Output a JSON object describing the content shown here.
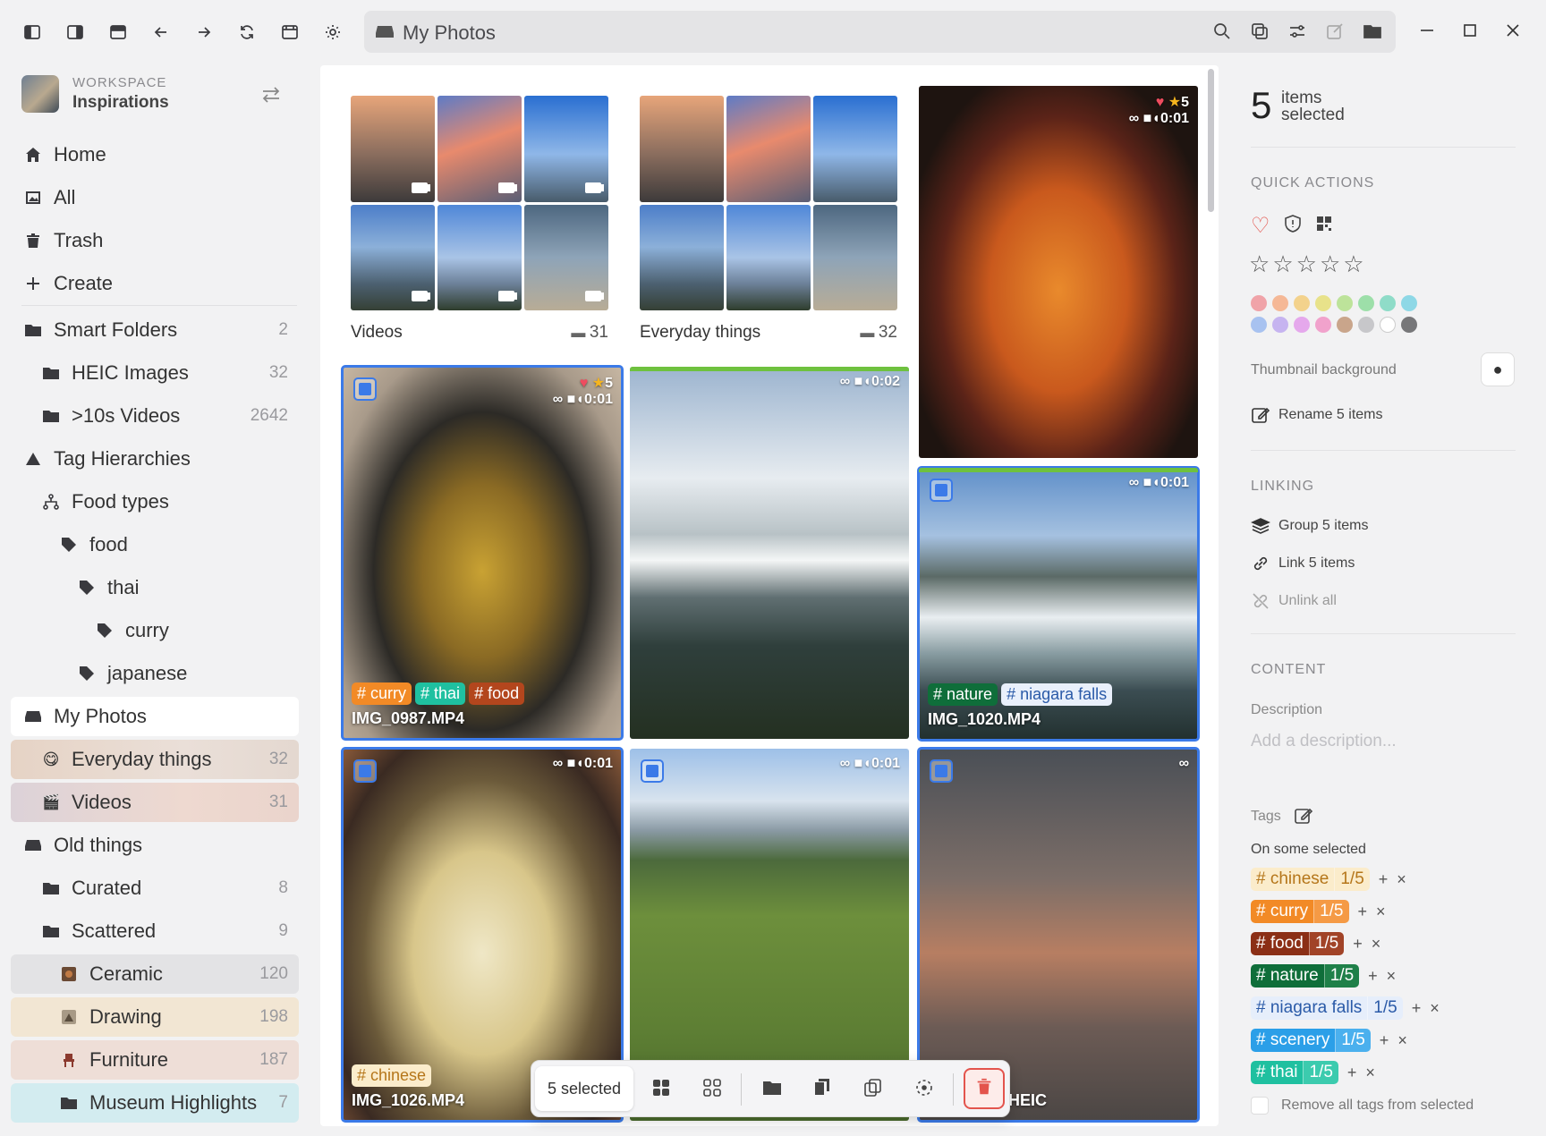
{
  "window": {
    "address_title": "My Photos"
  },
  "workspace": {
    "label": "WORKSPACE",
    "name": "Inspirations"
  },
  "sidebar": {
    "items": [
      {
        "label": "Home",
        "count": ""
      },
      {
        "label": "All",
        "count": ""
      },
      {
        "label": "Trash",
        "count": ""
      },
      {
        "label": "Create",
        "count": ""
      },
      {
        "label": "Smart Folders",
        "count": "2"
      },
      {
        "label": "HEIC Images",
        "count": "32"
      },
      {
        "label": ">10s Videos",
        "count": "2642"
      },
      {
        "label": "Tag Hierarchies",
        "count": ""
      },
      {
        "label": "Food types",
        "count": ""
      },
      {
        "label": "food",
        "count": ""
      },
      {
        "label": "thai",
        "count": ""
      },
      {
        "label": "curry",
        "count": ""
      },
      {
        "label": "japanese",
        "count": ""
      },
      {
        "label": "My Photos",
        "count": ""
      },
      {
        "label": "Everyday things",
        "count": "32"
      },
      {
        "label": "Videos",
        "count": "31"
      },
      {
        "label": "Old things",
        "count": ""
      },
      {
        "label": "Curated",
        "count": "8"
      },
      {
        "label": "Scattered",
        "count": "9"
      },
      {
        "label": "Ceramic",
        "count": "120"
      },
      {
        "label": "Drawing",
        "count": "198"
      },
      {
        "label": "Furniture",
        "count": "187"
      },
      {
        "label": "Museum Highlights",
        "count": "7"
      }
    ]
  },
  "folders": [
    {
      "name": "Videos",
      "count": "31"
    },
    {
      "name": "Everyday things",
      "count": "32"
    }
  ],
  "tiles": {
    "soup_top": {
      "rating": "5",
      "duration": "0:01"
    },
    "curry": {
      "rating": "5",
      "duration": "0:01",
      "filename": "IMG_0987.MP4",
      "tags": [
        "# curry",
        "# thai",
        "# food"
      ]
    },
    "niagara_big": {
      "duration": "0:02"
    },
    "niagara_small": {
      "duration": "0:01",
      "filename": "IMG_1020.MP4",
      "tags": [
        "# nature",
        "# niagara falls"
      ]
    },
    "chinese": {
      "duration": "0:01",
      "filename": "IMG_1026.MP4",
      "tags": [
        "# chinese"
      ]
    },
    "geese": {
      "duration": "0:01"
    },
    "bridge": {
      "filename_suffix": "HEIC"
    }
  },
  "toolbar": {
    "selected_label": "5 selected"
  },
  "right_panel": {
    "count": "5",
    "count_label_1": "items",
    "count_label_2": "selected",
    "quick_actions": "QUICK ACTIONS",
    "thumb_bg": "Thumbnail background",
    "rename": "Rename 5 items",
    "linking": "LINKING",
    "group": "Group 5 items",
    "link": "Link 5 items",
    "unlink": "Unlink all",
    "content": "CONTENT",
    "description_label": "Description",
    "description_placeholder": "Add a description...",
    "tags_label": "Tags",
    "on_some_selected": "On some selected",
    "tags": [
      {
        "name": "# chinese",
        "count": "1/5"
      },
      {
        "name": "# curry",
        "count": "1/5"
      },
      {
        "name": "# food",
        "count": "1/5"
      },
      {
        "name": "# nature",
        "count": "1/5"
      },
      {
        "name": "# niagara falls",
        "count": "1/5"
      },
      {
        "name": "# scenery",
        "count": "1/5"
      },
      {
        "name": "# thai",
        "count": "1/5"
      }
    ],
    "remove_all": "Remove all tags from selected",
    "colors": {
      "row1": [
        "#f0a3a8",
        "#f5b896",
        "#f3d28c",
        "#e8e28a",
        "#bde39a",
        "#9ddfa9",
        "#8fdcc8",
        "#8ed8e6"
      ],
      "row2": [
        "#a8c2f0",
        "#c6b4f0",
        "#e5a8ec",
        "#f1a2cc",
        "#c9a58b",
        "#c7c7ca",
        "#ffffff",
        "#777779"
      ]
    }
  }
}
